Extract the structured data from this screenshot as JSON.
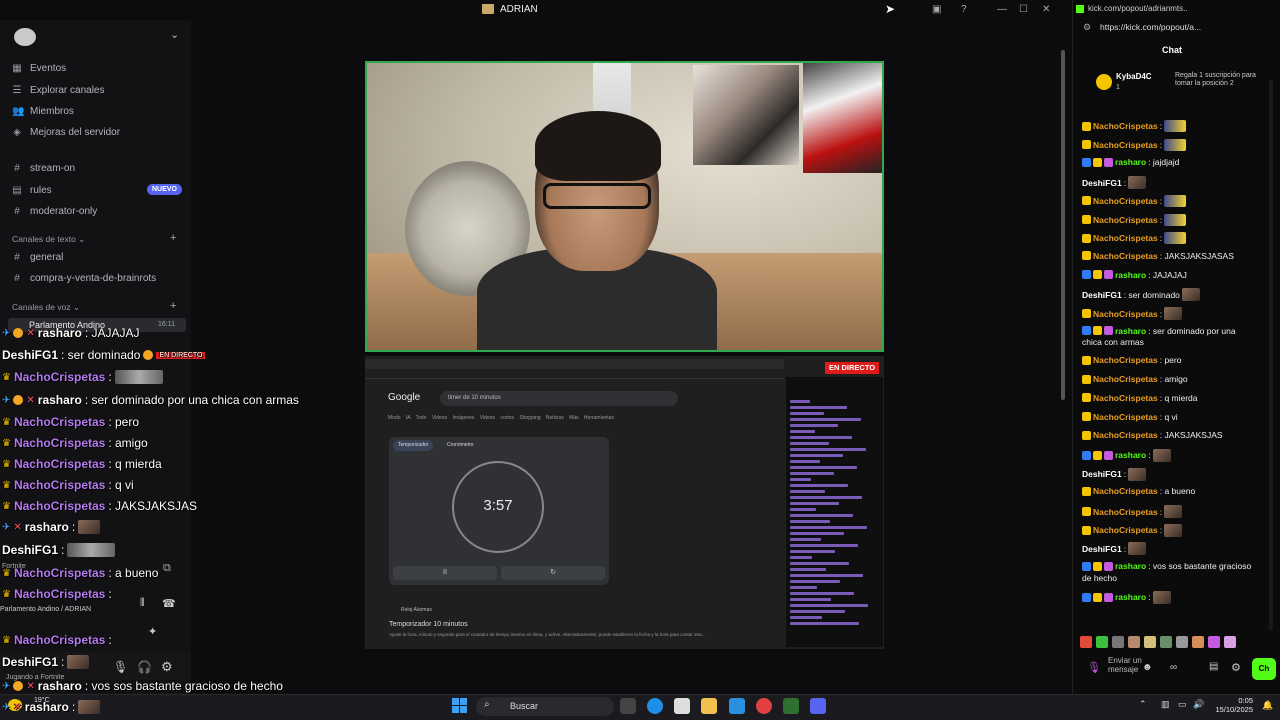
{
  "window": {
    "title": "ADRIAN"
  },
  "sidebar": {
    "top_items": [
      {
        "label": "Eventos",
        "icon": "calendar-icon"
      },
      {
        "label": "Explorar canales",
        "icon": "explore-icon"
      },
      {
        "label": "Miembros",
        "icon": "members-icon"
      },
      {
        "label": "Mejoras del servidor",
        "icon": "boost-icon"
      }
    ],
    "channels": [
      {
        "label": "stream-on",
        "icon": "hash-icon"
      },
      {
        "label": "rules",
        "icon": "rules-icon",
        "badge": "NUEVO"
      },
      {
        "label": "moderator-only",
        "icon": "hash-icon"
      }
    ],
    "text_category": "Canales de texto",
    "text_channels": [
      {
        "label": "general"
      },
      {
        "label": "compra-y-venta-de-brainrots"
      }
    ],
    "voice_category": "Canales de voz",
    "voice_channel": {
      "label": "Parlamento Andino",
      "time": "16:11"
    }
  },
  "overlay_chat": [
    {
      "user": "rasharo",
      "text": ": JAJAJAJ",
      "kind": "sword"
    },
    {
      "user": "DeshiFG1",
      "text": ": ser dominado",
      "kind": "plain",
      "extra": "EN DIRECTO"
    },
    {
      "user": "NachoCrispetas",
      "text": ":",
      "kind": "crown"
    },
    {
      "user": "rasharo",
      "text": ": ser dominado por una chica con armas",
      "kind": "sword"
    },
    {
      "user": "NachoCrispetas",
      "text": ": pero",
      "kind": "crown"
    },
    {
      "user": "NachoCrispetas",
      "text": ": amigo",
      "kind": "crown"
    },
    {
      "user": "NachoCrispetas",
      "text": ": q mierda",
      "kind": "crown"
    },
    {
      "user": "NachoCrispetas",
      "text": ": q vi",
      "kind": "crown"
    },
    {
      "user": "NachoCrispetas",
      "text": ": JAKSJAKSJAS",
      "kind": "crown"
    },
    {
      "user": "rasharo",
      "text": ":",
      "kind": "sword"
    },
    {
      "user": "DeshiFG1",
      "text": ":",
      "kind": "plain"
    },
    {
      "user": "NachoCrispetas",
      "text": ": a bueno",
      "kind": "crown"
    },
    {
      "user": "NachoCrispetas",
      "text": ":",
      "kind": "crown"
    },
    {
      "user": "NachoCrispetas",
      "text": ":",
      "kind": "crown"
    },
    {
      "user": "DeshiFG1",
      "text": ":",
      "kind": "plain"
    },
    {
      "user": "rasharo",
      "text": ": vos sos bastante gracioso de hecho",
      "kind": "sword"
    },
    {
      "user": "rasharo",
      "text": ":",
      "kind": "sword"
    }
  ],
  "user_panel": {
    "status1": "Fortnite",
    "status2": "Parlamento Andino / ADRIAN",
    "status3": "Jugando a Fortnite"
  },
  "stream": {
    "live_badge": "EN DIRECTO",
    "google_logo": "Google",
    "search_query": "timer de 10 minutos",
    "tabs": "Modo IA  Todo  Videos  Imágenes  Videos cortos  Shopping  Noticias  Más  Herramientas",
    "timer_tab1": "Temporizador",
    "timer_tab2": "Cronómetro",
    "timer_value": "3:57",
    "pause": "II",
    "reset": "↻",
    "result_site": "Reloj Alarmas",
    "result_title": "Temporizador 10 minutos",
    "result_desc": "Ajuste la hora, minuto y segundo para el contador de tiempo inverso en línea, y active. Alternativamente, puede establecer la fecha y la hora para contar otra..."
  },
  "kick": {
    "tab_url": "kick.com/popout/adrianmts...",
    "url": "https://kick.com/popout/a...",
    "chat_title": "Chat",
    "pinned_user": "KybaD4C",
    "pinned_count": "1",
    "pinned_note": "Regala 1 suscripción para tomar la posición 2",
    "messages": [
      {
        "user": "NachoCrispetas",
        "text": ":",
        "badges": "y",
        "color": "#e99f1f",
        "emote": "emote"
      },
      {
        "user": "NachoCrispetas",
        "text": ":",
        "badges": "y",
        "color": "#e99f1f",
        "emote": "emote"
      },
      {
        "user": "rasharo",
        "text": ": jajdjajd",
        "badges": "byp",
        "color": "#53fc18"
      },
      {
        "user": "DeshiFG1",
        "text": ":",
        "badges": "",
        "color": "#ffffff",
        "emote": "face"
      },
      {
        "user": "NachoCrispetas",
        "text": ":",
        "badges": "y",
        "color": "#e99f1f",
        "emote": "emote"
      },
      {
        "user": "NachoCrispetas",
        "text": ":",
        "badges": "y",
        "color": "#e99f1f",
        "emote": "emote"
      },
      {
        "user": "NachoCrispetas",
        "text": ":",
        "badges": "y",
        "color": "#e99f1f",
        "emote": "emote"
      },
      {
        "user": "NachoCrispetas",
        "text": ": JAKSJAKSJASAS",
        "badges": "y",
        "color": "#e99f1f"
      },
      {
        "user": "rasharo",
        "text": ": JAJAJAJ",
        "badges": "byp",
        "color": "#53fc18"
      },
      {
        "user": "DeshiFG1",
        "text": ": ser dominado",
        "badges": "",
        "color": "#ffffff",
        "emote": "face"
      },
      {
        "user": "NachoCrispetas",
        "text": ":",
        "badges": "y",
        "color": "#e99f1f",
        "emote": "face"
      },
      {
        "user": "rasharo",
        "text": ": ser dominado por una",
        "badges": "byp",
        "color": "#53fc18",
        "cont": "chica con armas"
      },
      {
        "user": "NachoCrispetas",
        "text": ": pero",
        "badges": "y",
        "color": "#e99f1f"
      },
      {
        "user": "NachoCrispetas",
        "text": ": amigo",
        "badges": "y",
        "color": "#e99f1f"
      },
      {
        "user": "NachoCrispetas",
        "text": ": q mierda",
        "badges": "y",
        "color": "#e99f1f"
      },
      {
        "user": "NachoCrispetas",
        "text": ": q vi",
        "badges": "y",
        "color": "#e99f1f"
      },
      {
        "user": "NachoCrispetas",
        "text": ": JAKSJAKSJAS",
        "badges": "y",
        "color": "#e99f1f"
      },
      {
        "user": "rasharo",
        "text": ":",
        "badges": "byp",
        "color": "#53fc18",
        "emote": "face"
      },
      {
        "user": "DeshiFG1",
        "text": ":",
        "badges": "",
        "color": "#ffffff",
        "emote": "face"
      },
      {
        "user": "NachoCrispetas",
        "text": ": a bueno",
        "badges": "y",
        "color": "#e99f1f"
      },
      {
        "user": "NachoCrispetas",
        "text": ":",
        "badges": "y",
        "color": "#e99f1f",
        "emote": "face"
      },
      {
        "user": "NachoCrispetas",
        "text": ":",
        "badges": "y",
        "color": "#e99f1f",
        "emote": "face"
      },
      {
        "user": "DeshiFG1",
        "text": ":",
        "badges": "",
        "color": "#ffffff",
        "emote": "face"
      },
      {
        "user": "rasharo",
        "text": ": vos sos bastante gracioso",
        "badges": "byp",
        "color": "#53fc18",
        "cont": "de hecho"
      },
      {
        "user": "rasharo",
        "text": ":",
        "badges": "byp",
        "color": "#53fc18",
        "emote": "face"
      }
    ],
    "input_placeholder": "Enviar un mensaje",
    "send": "Ch"
  },
  "taskbar": {
    "search": "Buscar",
    "time": "0:05",
    "date": "15/10/2025",
    "temp": "19°C"
  },
  "colors": {
    "kick_green": "#53fc18",
    "discord_blurple": "#5865f2",
    "live_red": "#e01b1b"
  }
}
